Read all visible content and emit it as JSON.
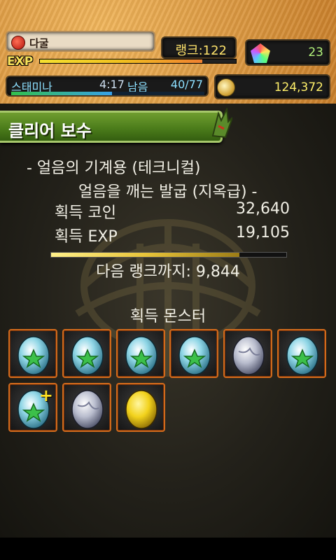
{
  "header": {
    "player_name": "다굴",
    "rank_label": "랭크:122",
    "exp_label": "EXP",
    "exp_progress": 0.83,
    "magic_stones": "23",
    "stamina_label": "스태미나",
    "stamina_timer": "4:17",
    "stamina_remaining_label": "남음",
    "stamina_value": "40/77",
    "stamina_progress": 0.52,
    "coins": "124,372"
  },
  "reward": {
    "title": "클리어 보수",
    "dungeon": "- 얼음의 기계용 (테크니컬)",
    "floor": "얼음을 깨는 발굽 (지옥급) -",
    "coin_label": "획득 코인",
    "coin_value": "32,640",
    "exp_label": "획득 EXP",
    "exp_value": "19,105",
    "next_rank_progress": 0.8,
    "next_rank_text": "다음 랭크까지: 9,844",
    "monsters_header": "획득 몬스터",
    "monsters": [
      {
        "egg": "blue-star",
        "plus": false
      },
      {
        "egg": "blue-star",
        "plus": false
      },
      {
        "egg": "blue-star",
        "plus": false
      },
      {
        "egg": "blue-star",
        "plus": false
      },
      {
        "egg": "silver",
        "plus": false
      },
      {
        "egg": "blue-star",
        "plus": false
      },
      {
        "egg": "blue-star",
        "plus": true
      },
      {
        "egg": "silver",
        "plus": false
      },
      {
        "egg": "gold",
        "plus": false
      }
    ]
  },
  "colors": {
    "slot_border": "#d06a1c",
    "banner_green": "#4c7d1b",
    "exp_bar": "#f4e030",
    "stamina_bar": "#31c04c"
  }
}
